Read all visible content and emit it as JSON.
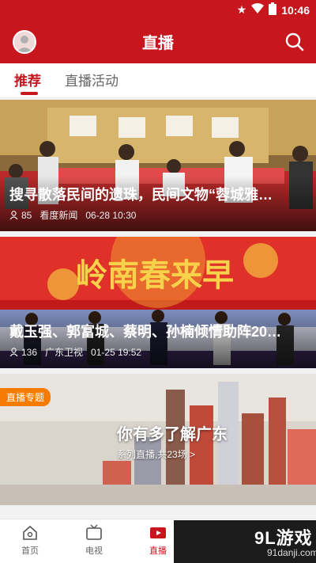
{
  "status_bar": {
    "time": "10:46"
  },
  "header": {
    "title": "直播"
  },
  "tabs": [
    {
      "label": "推荐",
      "active": true
    },
    {
      "label": "直播活动",
      "active": false
    }
  ],
  "feed": [
    {
      "headline": "搜寻散落民间的遗珠，民间文物“蓉城雅…",
      "views": "85",
      "source": "看度新闻",
      "time": "06-28 10:30"
    },
    {
      "headline": "戴玉强、郭富城、蔡明、孙楠倾情助阵20…",
      "views": "136",
      "source": "广东卫视",
      "time": "01-25 19:52"
    }
  ],
  "special": {
    "tag": "直播专题",
    "title": "你有多了解广东",
    "subtitle": "系列直播,共23场 >",
    "art_text": "你有多了解广东"
  },
  "bottom_nav": [
    {
      "label": "首页",
      "icon": "home-icon",
      "active": false
    },
    {
      "label": "电视",
      "icon": "tv-icon",
      "active": false
    },
    {
      "label": "直播",
      "icon": "live-icon",
      "active": true
    }
  ],
  "watermark": {
    "brand": "9L游戏",
    "url": "91danji.com"
  },
  "colors": {
    "brand_red": "#c8161e",
    "tag_orange": "#f57c00"
  }
}
